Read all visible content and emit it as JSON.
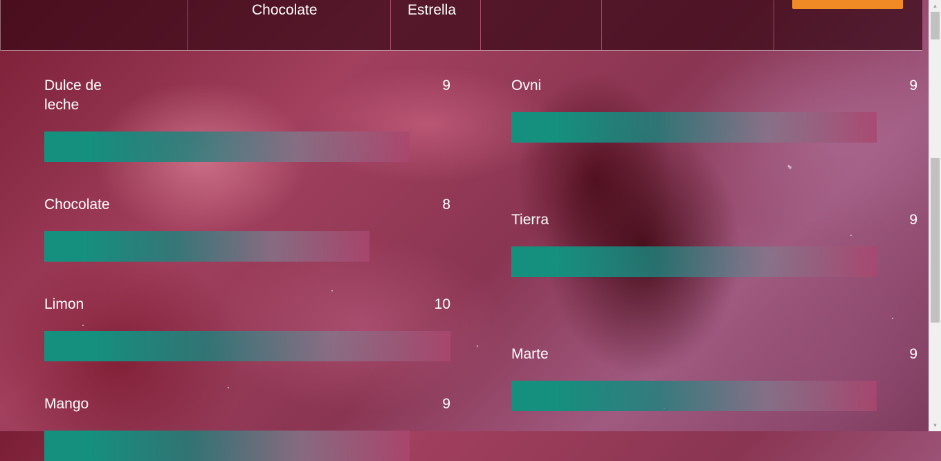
{
  "nav": {
    "items": [
      "Chocolate",
      "Estrella"
    ]
  },
  "flavors_left": [
    {
      "name": "Dulce de leche",
      "score": "9",
      "value": 9
    },
    {
      "name": "Chocolate",
      "score": "8",
      "value": 8
    },
    {
      "name": "Limon",
      "score": "10",
      "value": 10
    },
    {
      "name": "Mango",
      "score": "9",
      "value": 9
    }
  ],
  "flavors_right": [
    {
      "name": "Ovni",
      "score": "9",
      "value": 9
    },
    {
      "name": "Tierra",
      "score": "9",
      "value": 9
    },
    {
      "name": "Marte",
      "score": "9",
      "value": 9
    }
  ],
  "scale_max": 10,
  "colors": {
    "bar_start": "#15907f",
    "bar_end": "#aa466e",
    "cta": "#f08a24",
    "nav_bg": "#37081680"
  }
}
